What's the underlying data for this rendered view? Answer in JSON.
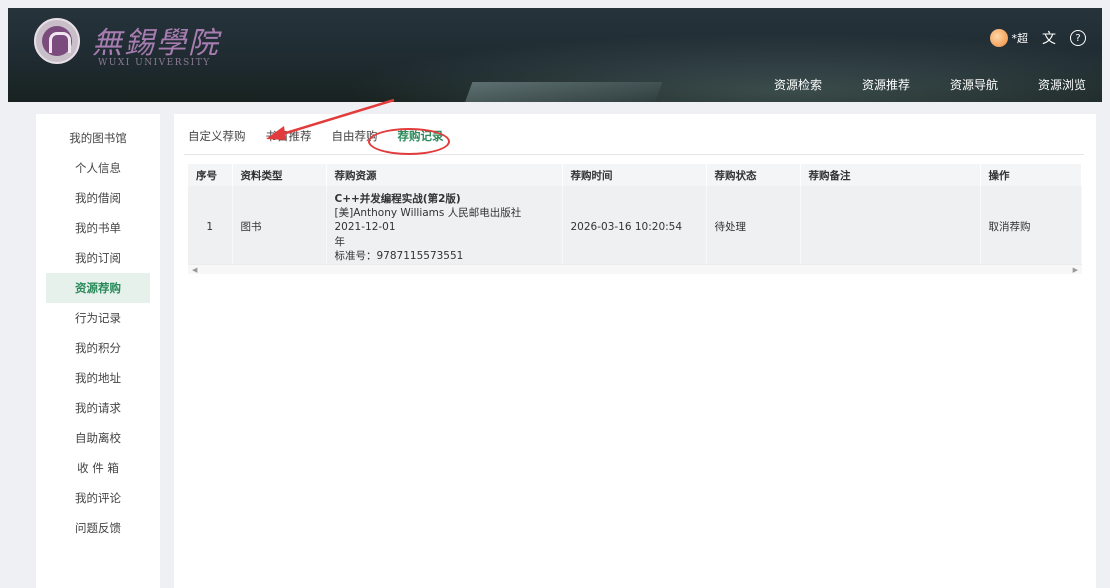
{
  "logo": {
    "cn": "無錫學院",
    "en": "WUXI UNIVERSITY"
  },
  "user": {
    "name": "*超"
  },
  "icons": {
    "language": "translate-icon",
    "help": "help-circle-icon"
  },
  "nav": [
    "资源检索",
    "资源推荐",
    "资源导航",
    "资源浏览"
  ],
  "sidebar": [
    "我的图书馆",
    "个人信息",
    "我的借阅",
    "我的书单",
    "我的订阅",
    "资源荐购",
    "行为记录",
    "我的积分",
    "我的地址",
    "我的请求",
    "自助离校",
    "收 件 箱",
    "我的评论",
    "问题反馈"
  ],
  "sidebar_active": "资源荐购",
  "tabs": [
    "自定义荐购",
    "书目推荐",
    "自由荐购",
    "荐购记录"
  ],
  "tabs_active": "荐购记录",
  "table": {
    "headers": [
      "序号",
      "资料类型",
      "荐购资源",
      "荐购时间",
      "荐购状态",
      "荐购备注",
      "操作"
    ],
    "row": {
      "index": "1",
      "type": "图书",
      "title": "C++并发编程实战(第2版)",
      "author_pub": "[美]Anthony Williams 人民邮电出版社 2021-12-01",
      "year_suffix": "年",
      "isbn": "标准号：9787115573551",
      "time": "2026-03-16 10:20:54",
      "status": "待处理",
      "note": "",
      "action": "取消荐购"
    }
  },
  "colors": {
    "accent": "#2b8a5a",
    "annotation": "#e23b3b",
    "danger": "#d9534f"
  }
}
